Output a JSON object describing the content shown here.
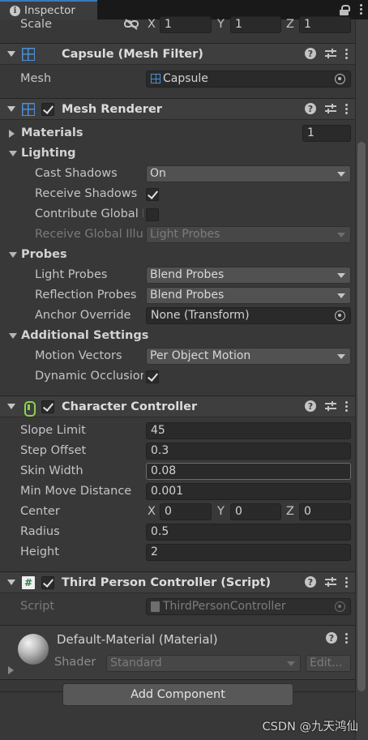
{
  "tab": {
    "title": "Inspector"
  },
  "transform": {
    "scale_label": "Scale",
    "x_label": "X",
    "y_label": "Y",
    "z_label": "Z",
    "x": "1",
    "y": "1",
    "z": "1"
  },
  "mesh_filter": {
    "title": "Capsule (Mesh Filter)",
    "mesh_label": "Mesh",
    "mesh_value": "Capsule"
  },
  "mesh_renderer": {
    "title": "Mesh Renderer",
    "materials_label": "Materials",
    "materials_count": "1",
    "lighting_label": "Lighting",
    "cast_shadows_label": "Cast Shadows",
    "cast_shadows_value": "On",
    "receive_shadows_label": "Receive Shadows",
    "contribute_gi_label": "Contribute Global I",
    "receive_gi_label": "Receive Global Illu",
    "receive_gi_value": "Light Probes",
    "probes_label": "Probes",
    "light_probes_label": "Light Probes",
    "light_probes_value": "Blend Probes",
    "reflection_probes_label": "Reflection Probes",
    "reflection_probes_value": "Blend Probes",
    "anchor_override_label": "Anchor Override",
    "anchor_override_value": "None (Transform)",
    "additional_label": "Additional Settings",
    "motion_vectors_label": "Motion Vectors",
    "motion_vectors_value": "Per Object Motion",
    "dynamic_occlusion_label": "Dynamic Occlusion"
  },
  "character_controller": {
    "title": "Character Controller",
    "slope_limit_label": "Slope Limit",
    "slope_limit": "45",
    "step_offset_label": "Step Offset",
    "step_offset": "0.3",
    "skin_width_label": "Skin Width",
    "skin_width": "0.08",
    "min_move_label": "Min Move Distance",
    "min_move": "0.001",
    "center_label": "Center",
    "x_label": "X",
    "y_label": "Y",
    "z_label": "Z",
    "center_x": "0",
    "center_y": "0",
    "center_z": "0",
    "radius_label": "Radius",
    "radius": "0.5",
    "height_label": "Height",
    "height": "2"
  },
  "script_component": {
    "title": "Third Person Controller (Script)",
    "script_label": "Script",
    "script_value": "ThirdPersonController"
  },
  "material": {
    "title": "Default-Material (Material)",
    "shader_label": "Shader",
    "shader_value": "Standard",
    "edit_label": "Edit..."
  },
  "add_component_label": "Add Component",
  "watermark": "CSDN @九天鸿仙"
}
